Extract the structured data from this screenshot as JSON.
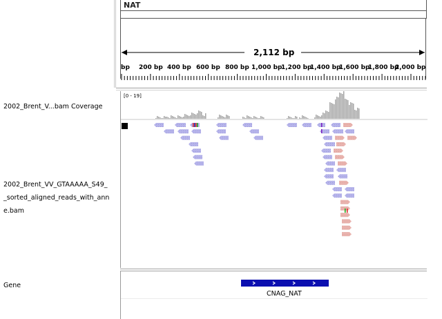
{
  "header": {
    "chromosome": "NAT",
    "span_label": "2,112 bp",
    "ruler_ticks": [
      "bp",
      "200 bp",
      "400 bp",
      "600 bp",
      "800 bp",
      "1,000 bp",
      "1,200 bp",
      "1,400 bp",
      "1,600 bp",
      "1,800 bp",
      "2,000 bp"
    ]
  },
  "tracks": {
    "coverage": {
      "name": "2002_Brent_V...bam Coverage",
      "range": "[0 - 19]",
      "color": "#a6a6a6"
    },
    "alignment": {
      "name_lines": [
        "2002_Brent_VV_GTAAAAA_S49_",
        "_sorted_aligned_reads_with_ann",
        "e.bam"
      ],
      "forward_color": "#b6b4ea",
      "reverse_color": "#e9b3ae"
    },
    "gene": {
      "name": "Gene",
      "feature_label": "CNAG_NAT",
      "feature_color": "#0b0fb0"
    }
  }
}
